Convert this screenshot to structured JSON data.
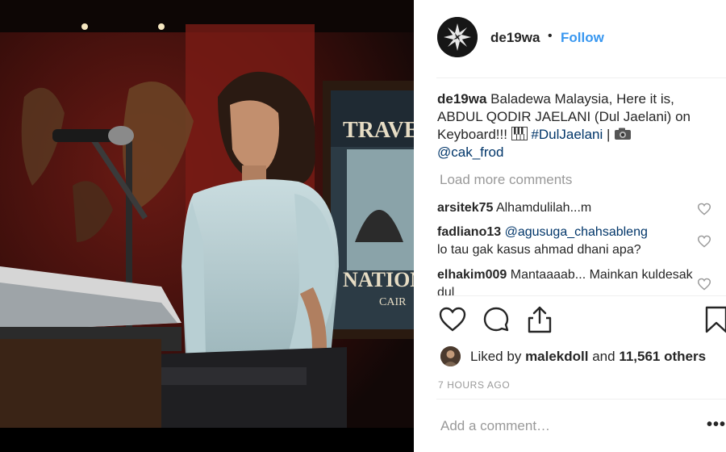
{
  "post": {
    "username": "de19wa",
    "separator": "•",
    "follow_label": "Follow"
  },
  "caption": {
    "username": "de19wa",
    "text_part1": "Baladewa Malaysia, Here it is, ABDUL QODIR JAELANI (Dul Jaelani) on Keyboard!!!",
    "hashtag": "#DulJaelani",
    "pipe": "|",
    "mention": "@cak_frod"
  },
  "load_more_label": "Load more comments",
  "comments": [
    {
      "username": "arsitek75",
      "text": "Alhamdulilah...m"
    },
    {
      "username": "fadliano13",
      "mention": "@agusuga_chahsableng",
      "text": "lo tau gak kasus ahmad dhani apa?"
    },
    {
      "username": "elhakim009",
      "text": "Mantaaaab... Mainkan kuldesak dul"
    }
  ],
  "likes": {
    "prefix": "Liked by",
    "user": "malekdoll",
    "and": "and",
    "count": "11,561 others"
  },
  "time_ago": "7 HOURS AGO",
  "add_comment_placeholder": "Add a comment…",
  "more_options": "•••",
  "icons": {
    "like": "heart-icon",
    "comment": "comment-bubble-icon",
    "share": "share-icon",
    "save": "bookmark-icon",
    "keyboard_emoji": "piano-keys-icon",
    "camera_emoji": "camera-icon"
  },
  "colors": {
    "link": "#3897f0",
    "hashtag": "#003569",
    "muted": "#999999",
    "text": "#262626"
  }
}
